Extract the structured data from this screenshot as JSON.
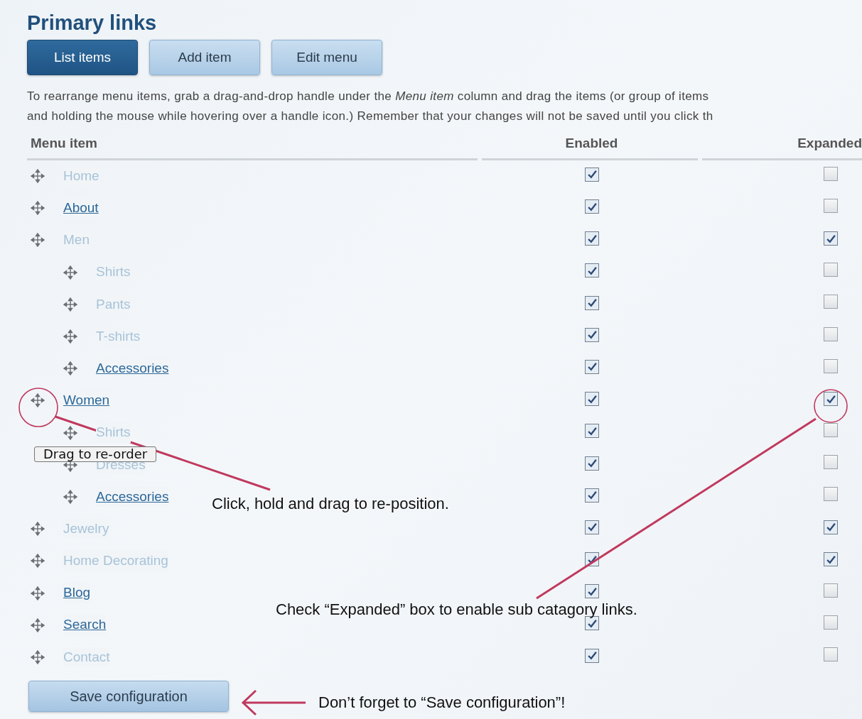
{
  "title": "Primary links",
  "tabs": [
    {
      "label": "List items",
      "selected": true
    },
    {
      "label": "Add item",
      "selected": false
    },
    {
      "label": "Edit menu",
      "selected": false
    }
  ],
  "intro_lines": [
    "To rearrange menu items, grab a drag-and-drop handle under the *Menu item* column and drag the items (or group of items",
    "and holding the mouse while hovering over a handle icon.) Remember that your changes will not be saved until you click th"
  ],
  "columns": [
    "Menu item",
    "Enabled",
    "Expanded"
  ],
  "items": [
    {
      "label": "Home",
      "faded": true,
      "enabled": true,
      "expanded": false
    },
    {
      "label": "About",
      "faded": false,
      "enabled": true,
      "expanded": false
    },
    {
      "label": "Men",
      "faded": true,
      "enabled": true,
      "expanded": true,
      "children": [
        {
          "label": "Shirts",
          "faded": true,
          "enabled": true,
          "expanded": false
        },
        {
          "label": "Pants",
          "faded": true,
          "enabled": true,
          "expanded": false
        },
        {
          "label": "T-shirts",
          "faded": true,
          "enabled": true,
          "expanded": false
        },
        {
          "label": "Accessories",
          "faded": false,
          "enabled": true,
          "expanded": false
        }
      ]
    },
    {
      "label": "Women",
      "faded": false,
      "enabled": true,
      "expanded": true,
      "children": [
        {
          "label": "Shirts",
          "faded": true,
          "enabled": true,
          "expanded": false
        },
        {
          "label": "Dresses",
          "faded": true,
          "enabled": true,
          "expanded": false
        },
        {
          "label": "Accessories",
          "faded": false,
          "enabled": true,
          "expanded": false
        }
      ]
    },
    {
      "label": "Jewelry",
      "faded": true,
      "enabled": true,
      "expanded": true
    },
    {
      "label": "Home Decorating",
      "faded": true,
      "enabled": true,
      "expanded": true
    },
    {
      "label": "Blog",
      "faded": false,
      "enabled": true,
      "expanded": false
    },
    {
      "label": "Search",
      "faded": false,
      "enabled": true,
      "expanded": false
    },
    {
      "label": "Contact",
      "faded": true,
      "enabled": true,
      "expanded": false
    }
  ],
  "save_button": "Save configuration",
  "tooltip": "Drag to re-order",
  "annotations": [
    {
      "kind": "drag",
      "text": "Click, hold and drag to re-position."
    },
    {
      "kind": "expand",
      "text": "Check “Expanded” box to enable sub catagory links."
    },
    {
      "kind": "save",
      "text": "Don’t forget to “Save configuration”!"
    }
  ]
}
